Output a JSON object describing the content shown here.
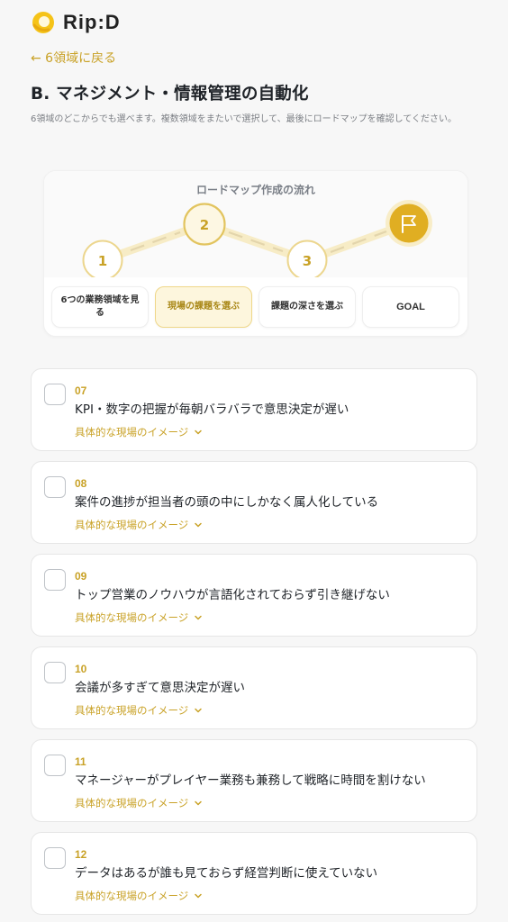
{
  "logo": {
    "text": "Rip:D"
  },
  "nav": {
    "back_label": "← 6領域に戻る"
  },
  "page": {
    "title": "B. マネジメント・情報管理の自動化",
    "description": "6領域のどこからでも選べます。複数領域をまたいで選択して、最後にロードマップを確認してください。"
  },
  "roadmap": {
    "title": "ロードマップ作成の流れ",
    "nodes": [
      "1",
      "2",
      "3"
    ],
    "goal_icon": "flag-icon",
    "steps": [
      {
        "label": "6つの業務領域を見る",
        "active": false
      },
      {
        "label": "現場の課題を選ぶ",
        "active": true
      },
      {
        "label": "課題の深さを選ぶ",
        "active": false
      },
      {
        "label": "GOAL",
        "active": false
      }
    ]
  },
  "issues": [
    {
      "num": "07",
      "text": "KPI・数字の把握が毎朝バラバラで意思決定が遅い",
      "more": "具体的な現場のイメージ",
      "checked": false
    },
    {
      "num": "08",
      "text": "案件の進捗が担当者の頭の中にしかなく属人化している",
      "more": "具体的な現場のイメージ",
      "checked": false
    },
    {
      "num": "09",
      "text": "トップ営業のノウハウが言語化されておらず引き継げない",
      "more": "具体的な現場のイメージ",
      "checked": false
    },
    {
      "num": "10",
      "text": "会議が多すぎて意思決定が遅い",
      "more": "具体的な現場のイメージ",
      "checked": false
    },
    {
      "num": "11",
      "text": "マネージャーがプレイヤー業務も兼務して戦略に時間を割けない",
      "more": "具体的な現場のイメージ",
      "checked": false
    },
    {
      "num": "12",
      "text": "データはあるが誰も見ておらず経営判断に使えていない",
      "more": "具体的な現場のイメージ",
      "checked": false
    }
  ],
  "colors": {
    "accent": "#c9a227",
    "accent_light": "#f7ecc6",
    "goal_fill": "#e0ae22"
  }
}
